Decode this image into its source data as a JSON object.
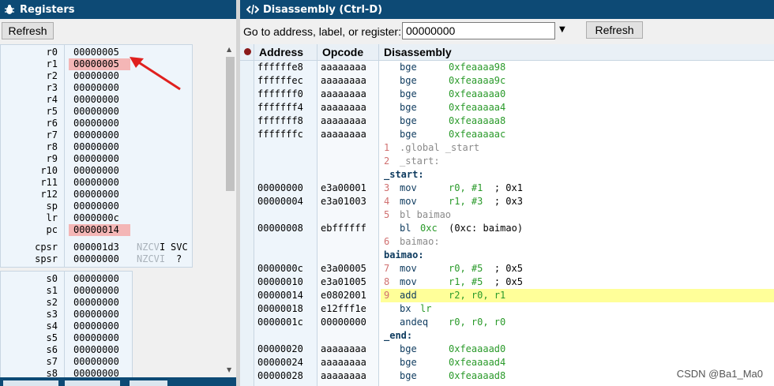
{
  "left_panel": {
    "title": "Registers",
    "refresh_label": "Refresh",
    "registers": [
      {
        "name": "r0",
        "value": "00000005",
        "highlight": false
      },
      {
        "name": "r1",
        "value": "00000005",
        "highlight": true
      },
      {
        "name": "r2",
        "value": "00000000",
        "highlight": false
      },
      {
        "name": "r3",
        "value": "00000000",
        "highlight": false
      },
      {
        "name": "r4",
        "value": "00000000",
        "highlight": false
      },
      {
        "name": "r5",
        "value": "00000000",
        "highlight": false
      },
      {
        "name": "r6",
        "value": "00000000",
        "highlight": false
      },
      {
        "name": "r7",
        "value": "00000000",
        "highlight": false
      },
      {
        "name": "r8",
        "value": "00000000",
        "highlight": false
      },
      {
        "name": "r9",
        "value": "00000000",
        "highlight": false
      },
      {
        "name": "r10",
        "value": "00000000",
        "highlight": false
      },
      {
        "name": "r11",
        "value": "00000000",
        "highlight": false
      },
      {
        "name": "r12",
        "value": "00000000",
        "highlight": false
      },
      {
        "name": "sp",
        "value": "00000000",
        "highlight": false
      },
      {
        "name": "lr",
        "value": "0000000c",
        "highlight": false
      },
      {
        "name": "pc",
        "value": "00000014",
        "highlight": true
      }
    ],
    "status_registers": [
      {
        "name": "cpsr",
        "value": "000001d3",
        "flags": "NZCV",
        "flag_extra": "I",
        "mode": "SVC"
      },
      {
        "name": "spsr",
        "value": "00000000",
        "flags": "NZCVI",
        "flag_extra": "",
        "mode": "?"
      }
    ],
    "s_registers": [
      {
        "name": "s0",
        "value": "00000000"
      },
      {
        "name": "s1",
        "value": "00000000"
      },
      {
        "name": "s2",
        "value": "00000000"
      },
      {
        "name": "s3",
        "value": "00000000"
      },
      {
        "name": "s4",
        "value": "00000000"
      },
      {
        "name": "s5",
        "value": "00000000"
      },
      {
        "name": "s6",
        "value": "00000000"
      },
      {
        "name": "s7",
        "value": "00000000"
      },
      {
        "name": "s8",
        "value": "00000000"
      }
    ]
  },
  "right_panel": {
    "title": "Disassembly (Ctrl-D)",
    "goto_label": "Go to address, label, or register:",
    "goto_value": "00000000",
    "refresh_label": "Refresh",
    "columns": [
      "Address",
      "Opcode",
      "Disassembly"
    ],
    "rows": [
      {
        "type": "ins",
        "addr": "ffffffe8",
        "op": "aaaaaaaa",
        "mn": "bge",
        "args": "0xfeaaaa98",
        "cmt": ""
      },
      {
        "type": "ins",
        "addr": "ffffffec",
        "op": "aaaaaaaa",
        "mn": "bge",
        "args": "0xfeaaaa9c",
        "cmt": ""
      },
      {
        "type": "ins",
        "addr": "fffffff0",
        "op": "aaaaaaaa",
        "mn": "bge",
        "args": "0xfeaaaaa0",
        "cmt": ""
      },
      {
        "type": "ins",
        "addr": "fffffff4",
        "op": "aaaaaaaa",
        "mn": "bge",
        "args": "0xfeaaaaa4",
        "cmt": ""
      },
      {
        "type": "ins",
        "addr": "fffffff8",
        "op": "aaaaaaaa",
        "mn": "bge",
        "args": "0xfeaaaaa8",
        "cmt": ""
      },
      {
        "type": "ins",
        "addr": "fffffffc",
        "op": "aaaaaaaa",
        "mn": "bge",
        "args": "0xfeaaaaac",
        "cmt": ""
      },
      {
        "type": "src",
        "ln": "1",
        "text": ".global _start"
      },
      {
        "type": "src",
        "ln": "2",
        "text": "_start:"
      },
      {
        "type": "label",
        "text": "_start:"
      },
      {
        "type": "ins",
        "addr": "00000000",
        "op": "e3a00001",
        "ln": "3",
        "mn": "mov",
        "args": "r0, #1",
        "cmt": "; 0x1"
      },
      {
        "type": "ins",
        "addr": "00000004",
        "op": "e3a01003",
        "ln": "4",
        "mn": "mov",
        "args": "r1, #3",
        "cmt": "; 0x3"
      },
      {
        "type": "src",
        "ln": "5",
        "text": "bl baimao",
        "dark": true
      },
      {
        "type": "ins",
        "addr": "00000008",
        "op": "ebffffff",
        "mn": "bl",
        "args": "0xc",
        "cmt": "(0xc: baimao)",
        "tight": true
      },
      {
        "type": "src",
        "ln": "6",
        "text": "baimao:"
      },
      {
        "type": "label",
        "text": "baimao:"
      },
      {
        "type": "ins",
        "addr": "0000000c",
        "op": "e3a00005",
        "ln": "7",
        "mn": "mov",
        "args": "r0, #5",
        "cmt": "; 0x5"
      },
      {
        "type": "ins",
        "addr": "00000010",
        "op": "e3a01005",
        "ln": "8",
        "mn": "mov",
        "args": "r1, #5",
        "cmt": "; 0x5"
      },
      {
        "type": "ins",
        "addr": "00000014",
        "op": "e0802001",
        "ln": "9",
        "mn": "add",
        "args": "r2, r0, r1",
        "cmt": "",
        "highlight": true
      },
      {
        "type": "ins",
        "addr": "00000018",
        "op": "e12fff1e",
        "mn": "bx",
        "args": "lr",
        "cmt": "",
        "tight": true
      },
      {
        "type": "ins",
        "addr": "0000001c",
        "op": "00000000",
        "mn": "andeq",
        "args": "r0, r0, r0",
        "cmt": ""
      },
      {
        "type": "label",
        "text": "_end:"
      },
      {
        "type": "ins",
        "addr": "00000020",
        "op": "aaaaaaaa",
        "mn": "bge",
        "args": "0xfeaaaad0",
        "cmt": ""
      },
      {
        "type": "ins",
        "addr": "00000024",
        "op": "aaaaaaaa",
        "mn": "bge",
        "args": "0xfeaaaad4",
        "cmt": ""
      },
      {
        "type": "ins",
        "addr": "00000028",
        "op": "aaaaaaaa",
        "mn": "bge",
        "args": "0xfeaaaad8",
        "cmt": ""
      }
    ]
  },
  "watermark": "CSDN @Ba1_Ma0",
  "colors": {
    "titlebar": "#0d4a75",
    "register_highlight": "#f4b6b6",
    "current_line": "#ffff99",
    "operand": "#2a9a2a",
    "annotation_arrow": "#e0201e"
  }
}
